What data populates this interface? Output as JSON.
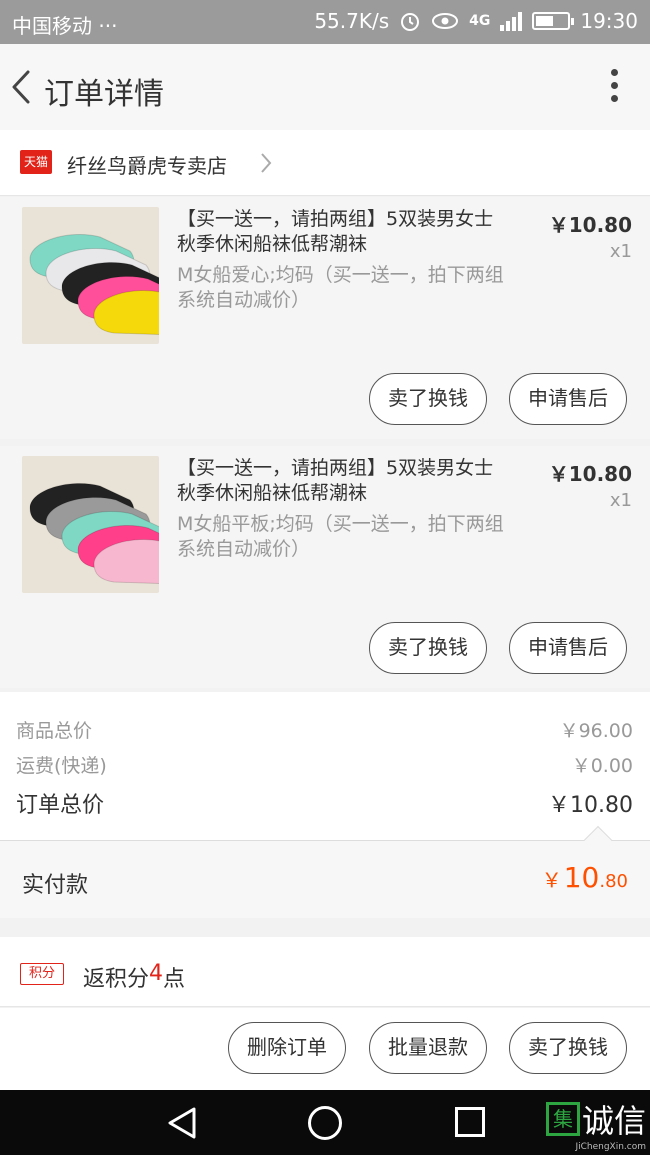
{
  "status_bar": {
    "carrier": "中国移动 ···",
    "speed": "55.7K/s",
    "network": "4G",
    "time": "19:30",
    "battery_level": 0.55
  },
  "header": {
    "title": "订单详情"
  },
  "shop": {
    "badge": "天猫",
    "name": "纤丝鸟爵虎专卖店"
  },
  "items": [
    {
      "name": "【买一送一，请拍两组】5双装男女士秋季休闲船袜低帮潮袜",
      "spec": "M女船爱心;均码（买一送一，拍下两组系统自动减价）",
      "price": "￥10.80",
      "qty": "x1",
      "btn_exchange": "卖了换钱",
      "btn_aftersale": "申请售后",
      "sock_colors": [
        "#7fd8c4",
        "#e8e8ea",
        "#222222",
        "#ff4f9a",
        "#f5d90a"
      ]
    },
    {
      "name": "【买一送一，请拍两组】5双装男女士秋季休闲船袜低帮潮袜",
      "spec": "M女船平板;均码（买一送一，拍下两组系统自动减价）",
      "price": "￥10.80",
      "qty": "x1",
      "btn_exchange": "卖了换钱",
      "btn_aftersale": "申请售后",
      "sock_colors": [
        "#222222",
        "#9a9a9a",
        "#7fd8c4",
        "#ff3f8a",
        "#f7b8cf"
      ]
    }
  ],
  "summary": {
    "goods_total_label": "商品总价",
    "goods_total": "￥96.00",
    "shipping_label": "运费(快递)",
    "shipping": "￥0.00",
    "order_total_label": "订单总价",
    "order_total": "￥10.80"
  },
  "paid": {
    "label": "实付款",
    "currency": "￥",
    "integer": "10",
    "decimal": ".80"
  },
  "points": {
    "badge": "积分",
    "text_prefix": "返积分",
    "value": "4",
    "text_suffix": "点"
  },
  "actions": {
    "delete": "删除订单",
    "batch_refund": "批量退款",
    "exchange": "卖了换钱"
  },
  "watermark": {
    "glyph": "集",
    "text": "诚信",
    "url": "JiChengXin.com"
  },
  "colors": {
    "accent": "#ff5000",
    "tmall_red": "#e2231a",
    "statusbar": "#9b9b9b"
  }
}
